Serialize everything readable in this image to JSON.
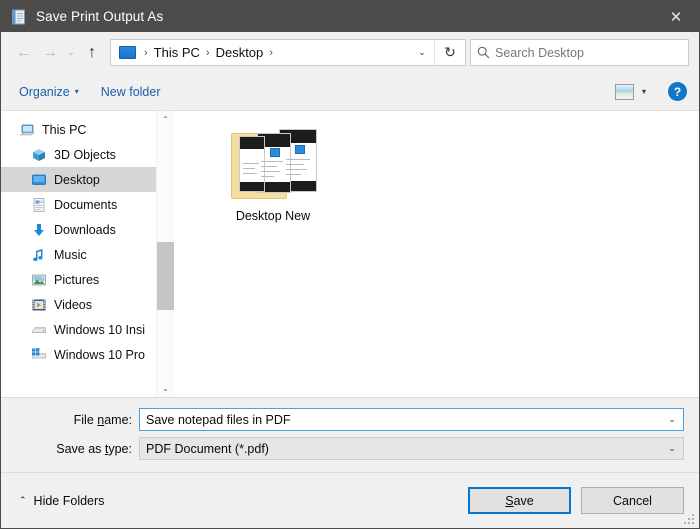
{
  "window": {
    "title": "Save Print Output As",
    "title_icon": "notepad-icon",
    "close_label": "✕"
  },
  "navigation": {
    "back_icon": "←",
    "forward_icon": "→",
    "recent_icon": "⌄",
    "up_icon": "↑",
    "breadcrumb": {
      "root_icon": "desktop-icon",
      "separator": "›",
      "items": [
        "This PC",
        "Desktop"
      ]
    },
    "history_caret": "⌄",
    "refresh_icon": "↻",
    "search": {
      "icon": "search-icon",
      "placeholder": "Search Desktop",
      "value": ""
    }
  },
  "toolbar": {
    "organize_label": "Organize",
    "organize_caret": "▾",
    "new_folder_label": "New folder",
    "view_icon": "picture-view-icon",
    "view_caret": "▾",
    "help_label": "?"
  },
  "sidebar": {
    "items": [
      {
        "label": "This PC",
        "icon": "pc-icon",
        "selected": false,
        "indent": false
      },
      {
        "label": "3D Objects",
        "icon": "cube-icon",
        "selected": false,
        "indent": true
      },
      {
        "label": "Desktop",
        "icon": "desktop-icon",
        "selected": true,
        "indent": true
      },
      {
        "label": "Documents",
        "icon": "document-icon",
        "selected": false,
        "indent": true
      },
      {
        "label": "Downloads",
        "icon": "download-icon",
        "selected": false,
        "indent": true
      },
      {
        "label": "Music",
        "icon": "music-icon",
        "selected": false,
        "indent": true
      },
      {
        "label": "Pictures",
        "icon": "pictures-icon",
        "selected": false,
        "indent": true
      },
      {
        "label": "Videos",
        "icon": "videos-icon",
        "selected": false,
        "indent": true
      },
      {
        "label": "Windows 10 Insi",
        "icon": "drive-icon",
        "selected": false,
        "indent": true
      },
      {
        "label": "Windows 10 Pro",
        "icon": "windows-drive-icon",
        "selected": false,
        "indent": true
      }
    ],
    "scroll_up_icon": "⌃",
    "scroll_down_icon": "⌄"
  },
  "files": [
    {
      "name": "Desktop New",
      "icon": "folder-icon"
    }
  ],
  "form": {
    "filename": {
      "label_pre": "File ",
      "label_accel": "n",
      "label_post": "ame:",
      "value": "Save notepad files in PDF",
      "caret": "⌄"
    },
    "filetype": {
      "label_pre": "Save as ",
      "label_accel": "t",
      "label_post": "ype:",
      "value": "PDF Document (*.pdf)",
      "caret": "⌄"
    }
  },
  "footer": {
    "hide_folders_caret": "⌃",
    "hide_folders_label": "Hide Folders",
    "save_pre": "",
    "save_accel": "S",
    "save_post": "ave",
    "cancel_label": "Cancel"
  },
  "colors": {
    "titlebar": "#4e4c4a",
    "accent": "#0078d7",
    "link": "#1b5fa8",
    "selection": "#d6d6d6",
    "chrome": "#f0f0f0"
  }
}
